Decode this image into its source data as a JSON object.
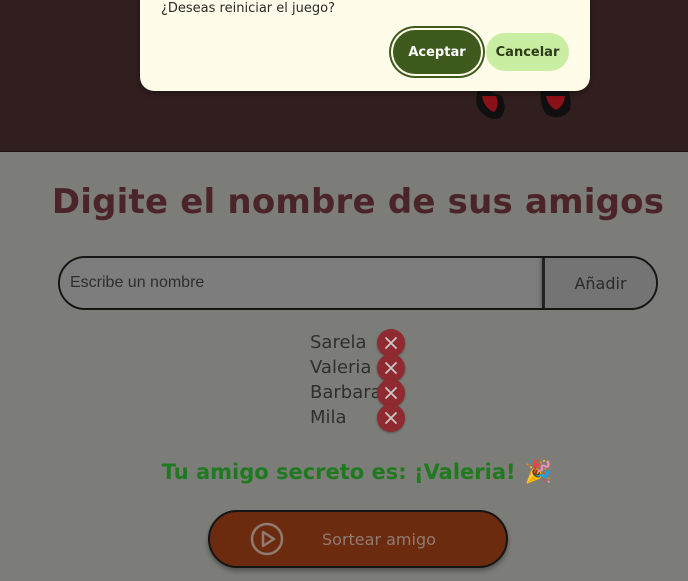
{
  "dialog": {
    "message": "¿Deseas reiniciar el juego?",
    "accept_label": "Aceptar",
    "cancel_label": "Cancelar"
  },
  "main": {
    "title": "Digite el nombre de sus amigos",
    "input_placeholder": "Escribe un nombre",
    "add_label": "Añadir",
    "friends": [
      "Sarela",
      "Valeria",
      "Barbara",
      "Mila"
    ],
    "result_text": "Tu amigo secreto es: ¡Valeria!",
    "result_emoji": "🎉",
    "draw_label": "Sortear amigo"
  },
  "colors": {
    "header_bg": "#311e1f",
    "overlay_bg": "#7c7c78",
    "title": "#4a2429",
    "accept_bg": "#3e5b1d",
    "cancel_bg": "#c9eda1",
    "result_text": "#1f7a1f",
    "remove_button": "#8f2a30",
    "draw_button": "#6c2b0f"
  },
  "icons": {
    "remove": "close-icon",
    "draw": "play-circle-icon",
    "celebration": "party-popper-icon"
  }
}
